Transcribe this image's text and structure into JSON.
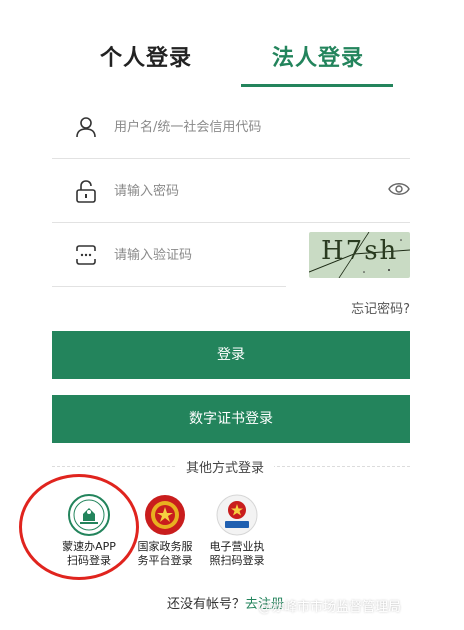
{
  "tabs": {
    "personal": "个人登录",
    "legal": "法人登录",
    "active": "legal"
  },
  "form": {
    "username_placeholder": "用户名/统一社会信用代码",
    "password_placeholder": "请输入密码",
    "captcha_placeholder": "请输入验证码",
    "captcha_text": "H7sh",
    "forgot_password": "忘记密码?"
  },
  "buttons": {
    "login": "登录",
    "cert_login": "数字证书登录"
  },
  "other_methods": {
    "title": "其他方式登录",
    "items": [
      {
        "line1": "蒙速办APP",
        "line2": "扫码登录",
        "icon": "mengsuban-app-icon"
      },
      {
        "line1": "国家政务服",
        "line2": "务平台登录",
        "icon": "national-emblem-icon"
      },
      {
        "line1": "电子营业执",
        "line2": "照扫码登录",
        "icon": "e-business-license-icon"
      }
    ]
  },
  "register": {
    "prompt": "还没有帐号？",
    "link": "去注册"
  },
  "watermark": "@赤峰市市场监督管理局",
  "colors": {
    "accent": "#23845c",
    "highlight": "#e0241e",
    "captcha_bg": "#c9dbc4"
  }
}
